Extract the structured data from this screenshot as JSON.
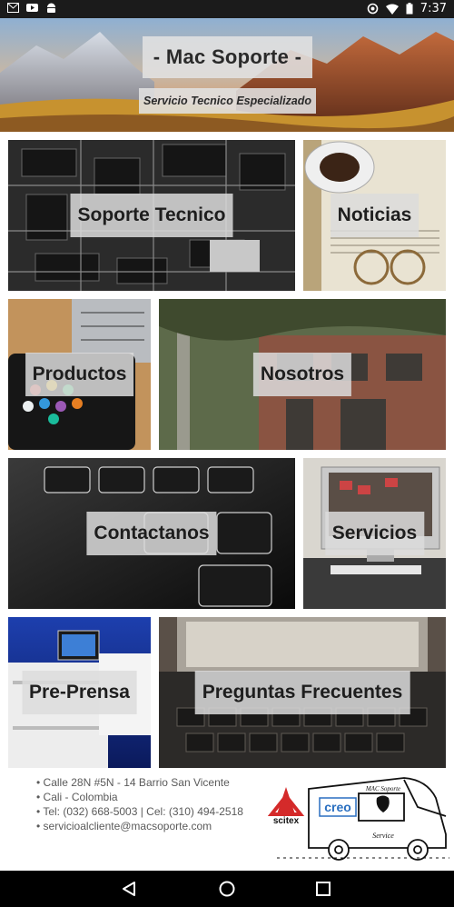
{
  "status_bar": {
    "time": "7:37",
    "left_icons": [
      "gmail-icon",
      "youtube-icon",
      "android-icon"
    ],
    "right_icons": [
      "data-saver-icon",
      "wifi-icon",
      "battery-icon"
    ]
  },
  "header": {
    "title": "- Mac Soporte -",
    "subtitle": "Servicio Tecnico Especializado"
  },
  "tiles": [
    {
      "label": "Soporte Tecnico"
    },
    {
      "label": "Noticias"
    },
    {
      "label": "Productos"
    },
    {
      "label": "Nosotros"
    },
    {
      "label": "Contactanos"
    },
    {
      "label": "Servicios"
    },
    {
      "label": "Pre-Prensa"
    },
    {
      "label": "Preguntas Frecuentes"
    }
  ],
  "contact": {
    "address": "Calle 28N #5N - 14 Barrio San Vicente",
    "city": "Cali - Colombia",
    "phone": "Tel: (032) 668-5003 | Cel: (310) 494-2518",
    "email": "servicioalcliente@macsoporte.com"
  },
  "logos": {
    "scitex": "scitex",
    "creo": "creo",
    "van_text_top": "MAC Soporte",
    "van_text_bottom": "Service"
  },
  "colors": {
    "status_bar": "#1b1b1b",
    "nav_bar": "#000000",
    "label_bg": "#dcdcdc",
    "scitex_red": "#d42a2a",
    "creo_blue": "#2a6fc0"
  }
}
